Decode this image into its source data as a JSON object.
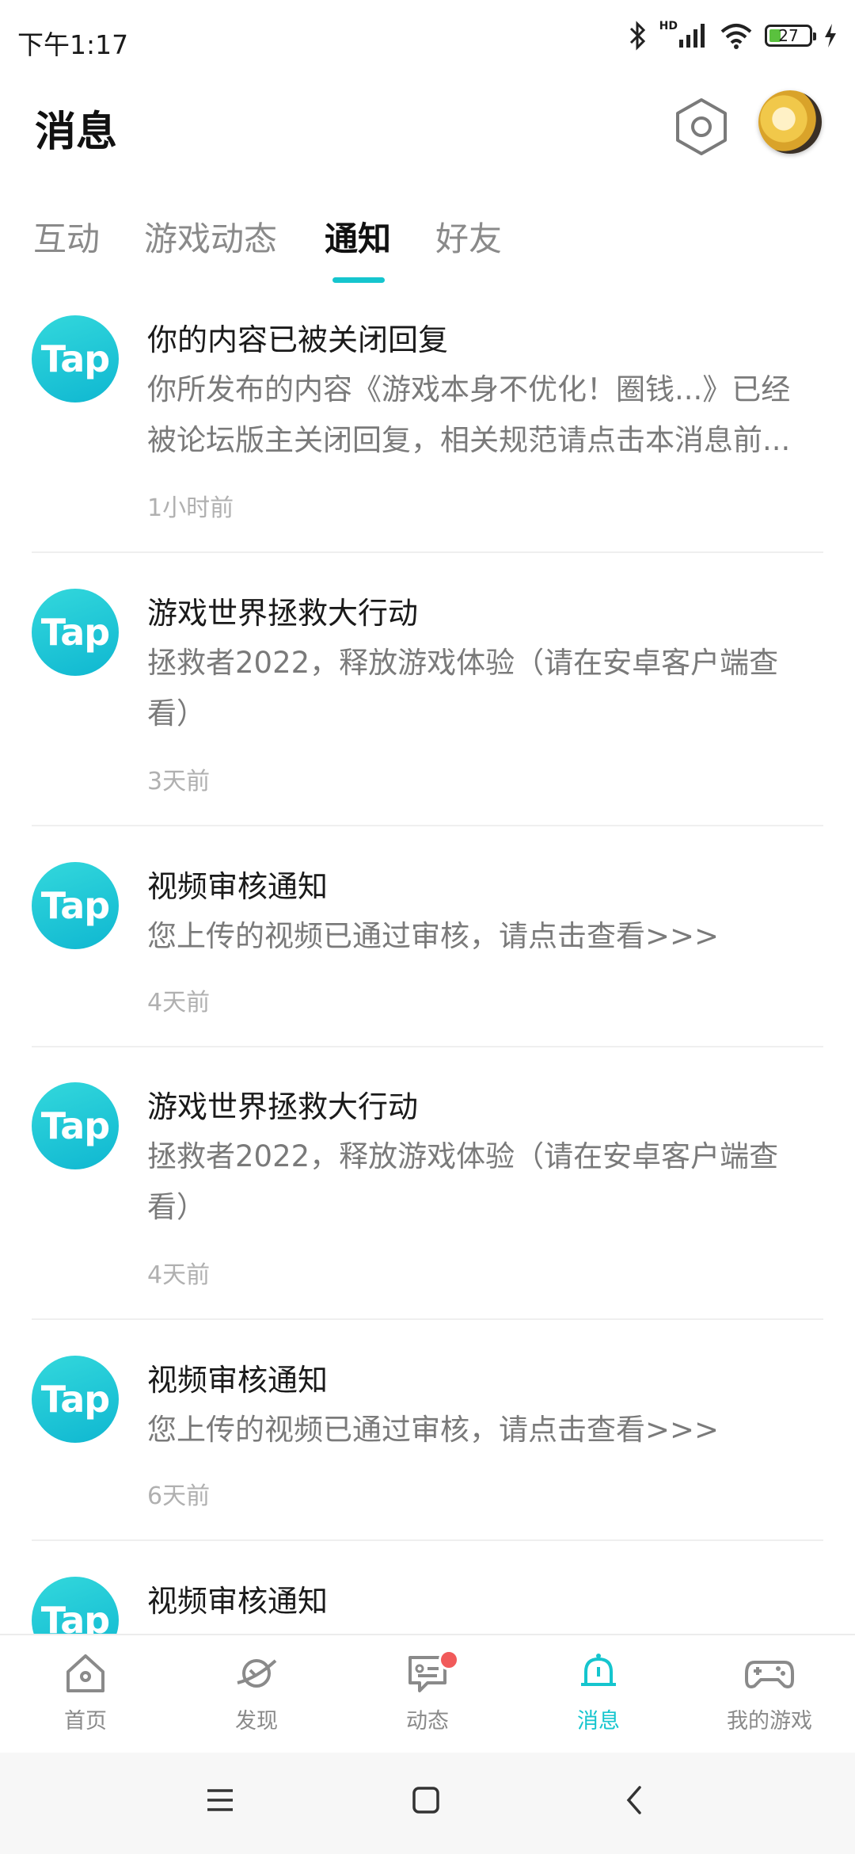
{
  "status": {
    "time": "下午1:17",
    "battery": "27",
    "network": "HD"
  },
  "header": {
    "title": "消息"
  },
  "tabs": [
    {
      "label": "互动",
      "active": false
    },
    {
      "label": "游戏动态",
      "active": false
    },
    {
      "label": "通知",
      "active": true
    },
    {
      "label": "好友",
      "active": false
    }
  ],
  "notifications": [
    {
      "logo": "Tap",
      "title": "你的内容已被关闭回复",
      "body": "你所发布的内容《游戏本身不优化！圈钱...》已经被论坛版主关闭回复，相关规范请点击本消息前...",
      "time": "1小时前"
    },
    {
      "logo": "Tap",
      "title": "游戏世界拯救大行动",
      "body": "拯救者2022，释放游戏体验（请在安卓客户端查看）",
      "time": "3天前"
    },
    {
      "logo": "Tap",
      "title": "视频审核通知",
      "body": "您上传的视频已通过审核，请点击查看>>>",
      "time": "4天前"
    },
    {
      "logo": "Tap",
      "title": "游戏世界拯救大行动",
      "body": "拯救者2022，释放游戏体验（请在安卓客户端查看）",
      "time": "4天前"
    },
    {
      "logo": "Tap",
      "title": "视频审核通知",
      "body": "您上传的视频已通过审核，请点击查看>>>",
      "time": "6天前"
    },
    {
      "logo": "Tap",
      "title": "视频审核通知"
    }
  ],
  "bottom_nav": [
    {
      "label": "首页",
      "icon": "home-icon"
    },
    {
      "label": "发现",
      "icon": "planet-icon"
    },
    {
      "label": "动态",
      "icon": "chat-icon",
      "badge": true
    },
    {
      "label": "消息",
      "icon": "bell-icon",
      "active": true
    },
    {
      "label": "我的游戏",
      "icon": "gamepad-icon"
    }
  ],
  "colors": {
    "accent": "#15c5ce",
    "badge": "#f15a5a",
    "logo_gradient_start": "#33d8dc",
    "logo_gradient_end": "#0fb7d1"
  }
}
